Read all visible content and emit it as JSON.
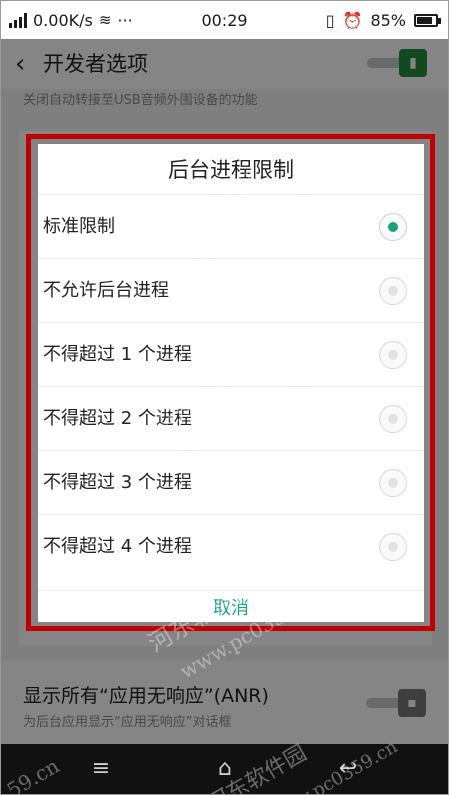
{
  "status_bar": {
    "network_badge": "4G",
    "speed": "0.00K/s",
    "more": "···",
    "time": "00:29",
    "battery_percent": "85%",
    "battery_level": 0.85
  },
  "app_bar": {
    "back_icon": "back-arrow-icon",
    "title": "开发者选项",
    "toggle_state": "on",
    "toggle_color": "#1f8f3a"
  },
  "background": {
    "hint_text": "关闭自动转接至USB音频外围设备的功能",
    "anr_title": "显示所有“应用无响应”(ANR)",
    "anr_subtitle": "为后台应用显示“应用无响应”对话框",
    "anr_toggle_state": "off"
  },
  "dialog": {
    "title": "后台进程限制",
    "options": [
      {
        "label": "标准限制",
        "selected": true
      },
      {
        "label": "不允许后台进程",
        "selected": false
      },
      {
        "label": "不得超过 1 个进程",
        "selected": false
      },
      {
        "label": "不得超过 2 个进程",
        "selected": false
      },
      {
        "label": "不得超过 3 个进程",
        "selected": false
      },
      {
        "label": "不得超过 4 个进程",
        "selected": false
      }
    ],
    "cancel_label": "取消",
    "accent_color": "#19a57c"
  },
  "annotation_color": "#c00000",
  "nav_bar": {
    "menu_icon": "menu-icon",
    "home_icon": "home-icon",
    "back_icon": "back-icon"
  },
  "watermark": {
    "text_cn": "河东软件园",
    "text_url": "www.pc0359.cn",
    "text_short": "59.cn"
  }
}
